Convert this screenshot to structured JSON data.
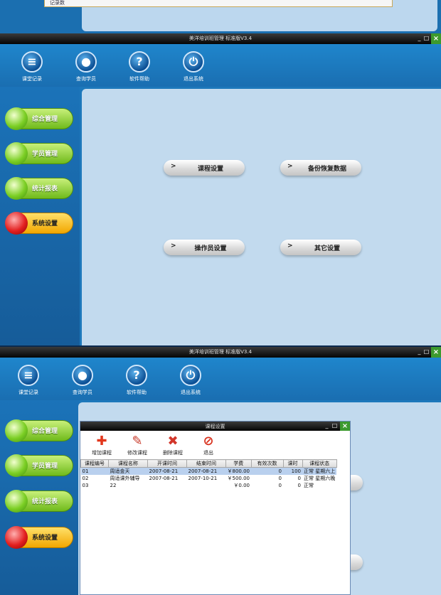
{
  "strip": {
    "text": "记录数"
  },
  "app": {
    "title": "美洋培训班管理 标准版V3.4",
    "toolbar": [
      {
        "label": "课堂记录",
        "icon": "document-icon"
      },
      {
        "label": "查询学员",
        "icon": "person-icon"
      },
      {
        "label": "软件帮助",
        "icon": "help-icon"
      },
      {
        "label": "退出系统",
        "icon": "power-icon"
      }
    ],
    "nav": [
      {
        "label": "综合管理",
        "active": false
      },
      {
        "label": "学员管理",
        "active": false
      },
      {
        "label": "统计报表",
        "active": false
      },
      {
        "label": "系统设置",
        "active": true
      }
    ]
  },
  "settings": {
    "course_settings": "课程设置",
    "backup_restore": "备份恢复数据",
    "operator_settings": "操作员设置",
    "other_settings": "其它设置",
    "arrow": ">"
  },
  "dialog": {
    "title": "课程设置",
    "tools": [
      {
        "label": "增加课程",
        "icon": "plus-icon",
        "glyph": "✚",
        "color": "#e2361c"
      },
      {
        "label": "修改课程",
        "icon": "wrench-icon",
        "glyph": "✎",
        "color": "#c83a2a"
      },
      {
        "label": "删除课程",
        "icon": "delete-icon",
        "glyph": "✖",
        "color": "#d2362a"
      },
      {
        "label": "退出",
        "icon": "stop-icon",
        "glyph": "⊘",
        "color": "#d8301c"
      }
    ],
    "columns": [
      "课程编号",
      "课程名称",
      "开课时间",
      "结束时间",
      "学费",
      "有效次数",
      "课时",
      "课程状态"
    ],
    "rows": [
      [
        "01",
        "周适金天",
        "2007-08-21",
        "2007-08-21",
        "￥800.00",
        "0",
        "100",
        "正常",
        "星期六上"
      ],
      [
        "02",
        "周适课外辅导",
        "2007-08-21",
        "2007-10-21",
        "￥500.00",
        "0",
        "0",
        "正常",
        "星期六晚"
      ],
      [
        "03",
        "22",
        "",
        "",
        "￥0.00",
        "0",
        "0",
        "正常",
        ""
      ]
    ]
  },
  "colors": {
    "accent": "#1d78bb",
    "content_bg": "#c2daee",
    "nav_green": "#7ccf25",
    "nav_red": "#e32020",
    "close_green": "#3d9a2e"
  }
}
